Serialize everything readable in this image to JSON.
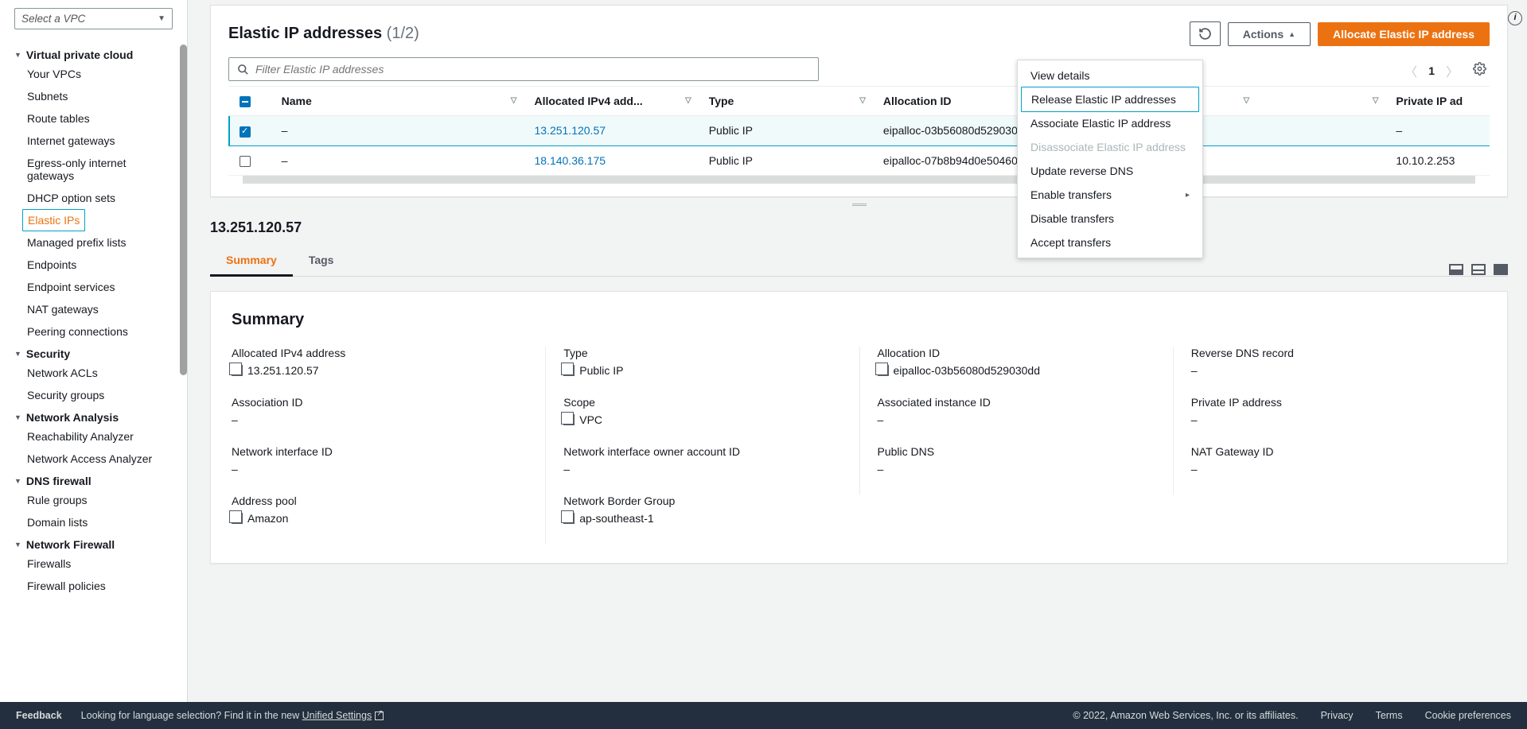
{
  "sidebar": {
    "vpc_selector_placeholder": "Select a VPC",
    "sections": {
      "vpc": {
        "title": "Virtual private cloud",
        "items": [
          "Your VPCs",
          "Subnets",
          "Route tables",
          "Internet gateways",
          "Egress-only internet gateways",
          "DHCP option sets",
          "Elastic IPs",
          "Managed prefix lists",
          "Endpoints",
          "Endpoint services",
          "NAT gateways",
          "Peering connections"
        ]
      },
      "security": {
        "title": "Security",
        "items": [
          "Network ACLs",
          "Security groups"
        ]
      },
      "analysis": {
        "title": "Network Analysis",
        "items": [
          "Reachability Analyzer",
          "Network Access Analyzer"
        ]
      },
      "dnsfw": {
        "title": "DNS firewall",
        "items": [
          "Rule groups",
          "Domain lists"
        ]
      },
      "netfw": {
        "title": "Network Firewall",
        "items": [
          "Firewalls",
          "Firewall policies"
        ]
      }
    },
    "active_item": "Elastic IPs"
  },
  "header": {
    "title": "Elastic IP addresses",
    "count": "(1/2)",
    "actions_label": "Actions",
    "allocate_label": "Allocate Elastic IP address",
    "search_placeholder": "Filter Elastic IP addresses",
    "page": "1"
  },
  "actions_menu": {
    "items": [
      {
        "label": "View details",
        "state": "normal"
      },
      {
        "label": "Release Elastic IP addresses",
        "state": "highlighted"
      },
      {
        "label": "Associate Elastic IP address",
        "state": "normal"
      },
      {
        "label": "Disassociate Elastic IP address",
        "state": "disabled"
      },
      {
        "label": "Update reverse DNS",
        "state": "normal"
      },
      {
        "label": "Enable transfers",
        "state": "submenu"
      },
      {
        "label": "Disable transfers",
        "state": "normal"
      },
      {
        "label": "Accept transfers",
        "state": "normal"
      }
    ]
  },
  "table": {
    "columns": [
      "Name",
      "Allocated IPv4 add...",
      "Type",
      "Allocation ID",
      "Reverse DNS record",
      "",
      "Private IP ad"
    ],
    "rows": [
      {
        "selected": true,
        "name": "–",
        "ipv4": "13.251.120.57",
        "type": "Public IP",
        "alloc": "eipalloc-03b56080d529030dd",
        "rdns": "–",
        "priv": "–"
      },
      {
        "selected": false,
        "name": "–",
        "ipv4": "18.140.36.175",
        "type": "Public IP",
        "alloc": "eipalloc-07b8b94d0e5046073",
        "rdns": "–",
        "priv": "10.10.2.253"
      }
    ]
  },
  "detail": {
    "ip": "13.251.120.57",
    "tabs": {
      "summary": "Summary",
      "tags": "Tags"
    },
    "summary_heading": "Summary",
    "fields": [
      {
        "label": "Allocated IPv4 address",
        "value": "13.251.120.57",
        "copy": true
      },
      {
        "label": "Type",
        "value": "Public IP",
        "copy": true
      },
      {
        "label": "Allocation ID",
        "value": "eipalloc-03b56080d529030dd",
        "copy": true
      },
      {
        "label": "Reverse DNS record",
        "value": "–",
        "copy": false
      },
      {
        "label": "Association ID",
        "value": "–",
        "copy": false
      },
      {
        "label": "Scope",
        "value": "VPC",
        "copy": true
      },
      {
        "label": "Associated instance ID",
        "value": "–",
        "copy": false
      },
      {
        "label": "Private IP address",
        "value": "–",
        "copy": false
      },
      {
        "label": "Network interface ID",
        "value": "–",
        "copy": false
      },
      {
        "label": "Network interface owner account ID",
        "value": "–",
        "copy": false
      },
      {
        "label": "Public DNS",
        "value": "–",
        "copy": false
      },
      {
        "label": "NAT Gateway ID",
        "value": "–",
        "copy": false
      },
      {
        "label": "Address pool",
        "value": "Amazon",
        "copy": true
      },
      {
        "label": "Network Border Group",
        "value": "ap-southeast-1",
        "copy": true
      }
    ]
  },
  "footer": {
    "feedback": "Feedback",
    "lang_hint": "Looking for language selection? Find it in the new ",
    "unified": "Unified Settings",
    "copyright": "© 2022, Amazon Web Services, Inc. or its affiliates.",
    "privacy": "Privacy",
    "terms": "Terms",
    "cookies": "Cookie preferences"
  }
}
